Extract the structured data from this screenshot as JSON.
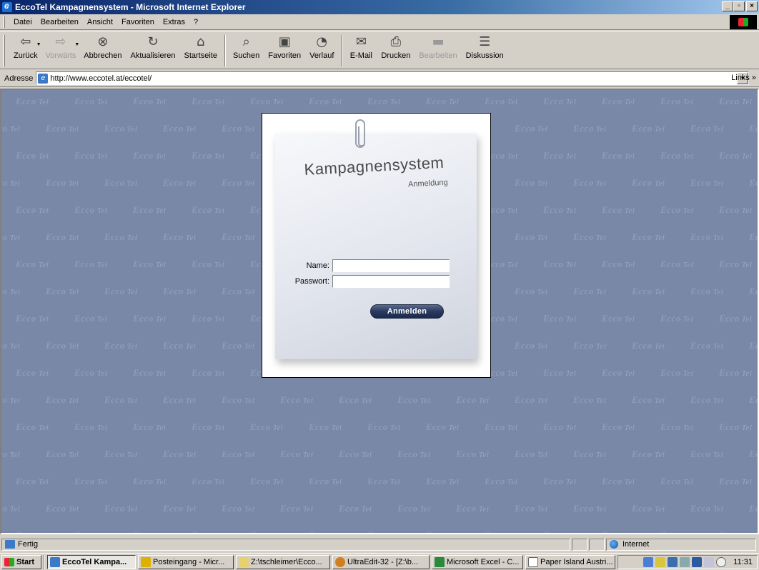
{
  "window": {
    "title": "EccoTel Kampagnensystem - Microsoft Internet Explorer"
  },
  "menu": [
    "Datei",
    "Bearbeiten",
    "Ansicht",
    "Favoriten",
    "Extras",
    "?"
  ],
  "toolbar": {
    "buttons": [
      {
        "label": "Zurück",
        "icon": "back-arrow-icon"
      },
      {
        "label": "Vorwärts",
        "icon": "forward-arrow-icon"
      },
      {
        "label": "Abbrechen",
        "icon": "stop-icon"
      },
      {
        "label": "Aktualisieren",
        "icon": "refresh-icon"
      },
      {
        "label": "Startseite",
        "icon": "home-icon"
      },
      {
        "label": "Suchen",
        "icon": "search-icon"
      },
      {
        "label": "Favoriten",
        "icon": "favorites-icon"
      },
      {
        "label": "Verlauf",
        "icon": "history-icon"
      },
      {
        "label": "E-Mail",
        "icon": "mail-icon"
      },
      {
        "label": "Drucken",
        "icon": "print-icon"
      },
      {
        "label": "Bearbeiten",
        "icon": "edit-icon"
      },
      {
        "label": "Diskussion",
        "icon": "discussion-icon"
      }
    ]
  },
  "address": {
    "label": "Adresse",
    "url": "http://www.eccotel.at/eccotel/",
    "links_label": "Links »"
  },
  "content": {
    "background_logo_text": "Ecco",
    "background_logo_suffix": "Tel",
    "login": {
      "title": "Kampagnensystem",
      "subtitle": "Anmeldung",
      "name_label": "Name:",
      "name_value": "",
      "password_label": "Passwort:",
      "password_value": "",
      "submit_label": "Anmelden"
    }
  },
  "status": {
    "text": "Fertig",
    "zone": "Internet"
  },
  "taskbar": {
    "start_label": "Start",
    "tasks": [
      {
        "label": "EccoTel Kampa...",
        "active": true,
        "color": "#3b79c9"
      },
      {
        "label": "Posteingang - Micr...",
        "active": false,
        "color": "#e0b000"
      },
      {
        "label": "Z:\\tschleimer\\Ecco...",
        "active": false,
        "color": "#e8d070"
      },
      {
        "label": "UltraEdit-32 - [Z:\\b...",
        "active": false,
        "color": "#d08020"
      },
      {
        "label": "Microsoft Excel - C...",
        "active": false,
        "color": "#2a8a3a"
      },
      {
        "label": "Paper Island Austri...",
        "active": false,
        "color": "#9a9a9a"
      }
    ],
    "clock": "11:31"
  },
  "colors": {
    "titlebar_start": "#0a246a",
    "titlebar_end": "#a6caf0",
    "content_bg": "#7a88a8",
    "submit_button": "#2a3a5e"
  }
}
